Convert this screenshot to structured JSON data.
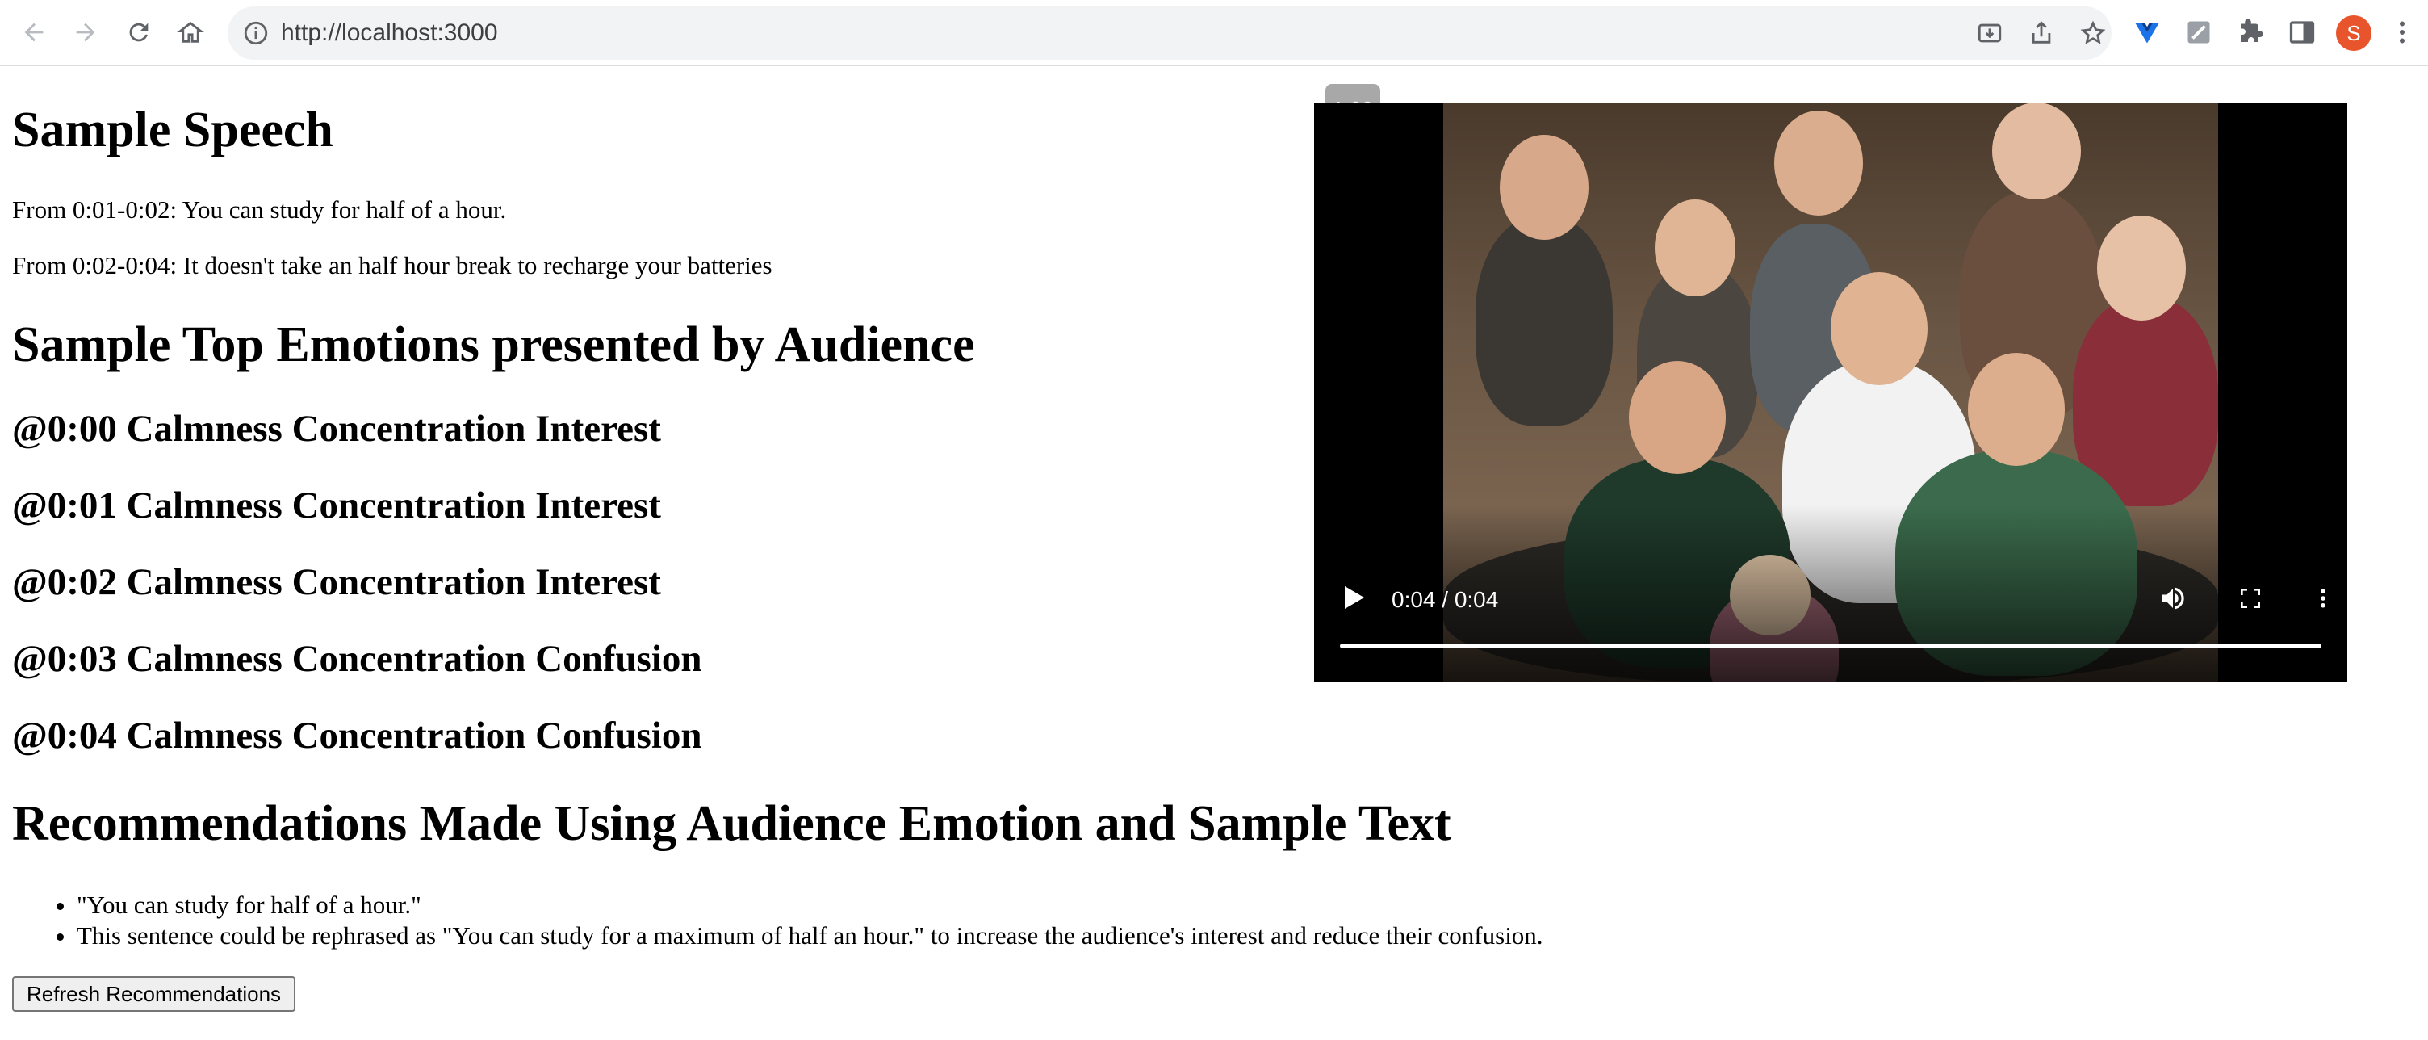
{
  "browser": {
    "url": "http://localhost:3000",
    "avatar_initial": "S"
  },
  "speech": {
    "title": "Sample Speech",
    "lines": [
      "From 0:01-0:02: You can study for half of a hour.",
      "From 0:02-0:04: It doesn't take an half hour break to recharge your batteries"
    ]
  },
  "emotions": {
    "title": "Sample Top Emotions presented by Audience",
    "entries": [
      "@0:00 Calmness Concentration Interest",
      "@0:01 Calmness Concentration Interest",
      "@0:02 Calmness Concentration Interest",
      "@0:03 Calmness Concentration Confusion",
      "@0:04 Calmness Concentration Confusion"
    ]
  },
  "recommendations": {
    "title": "Recommendations Made Using Audience Emotion and Sample Text",
    "items": [
      "\"You can study for half of a hour.\"",
      "This sentence could be rephrased as \"You can study for a maximum of half an hour.\" to increase the audience's interest and reduce their confusion."
    ],
    "refresh_label": "Refresh Recommendations"
  },
  "video": {
    "time_display": "0:04 / 0:04",
    "playback_rate": "1.00",
    "progress_fraction": 1.0
  },
  "icons": {
    "back": "arrow-left-icon",
    "forward": "arrow-right-icon",
    "reload": "reload-icon",
    "home": "home-icon",
    "info": "info-icon",
    "install": "install-icon",
    "share": "share-icon",
    "bookmark": "star-icon",
    "extensions": "puzzle-icon",
    "sidepanel": "sidepanel-icon",
    "menu": "kebab-menu-icon",
    "play": "play-icon",
    "volume": "volume-icon",
    "fullscreen": "fullscreen-icon"
  }
}
